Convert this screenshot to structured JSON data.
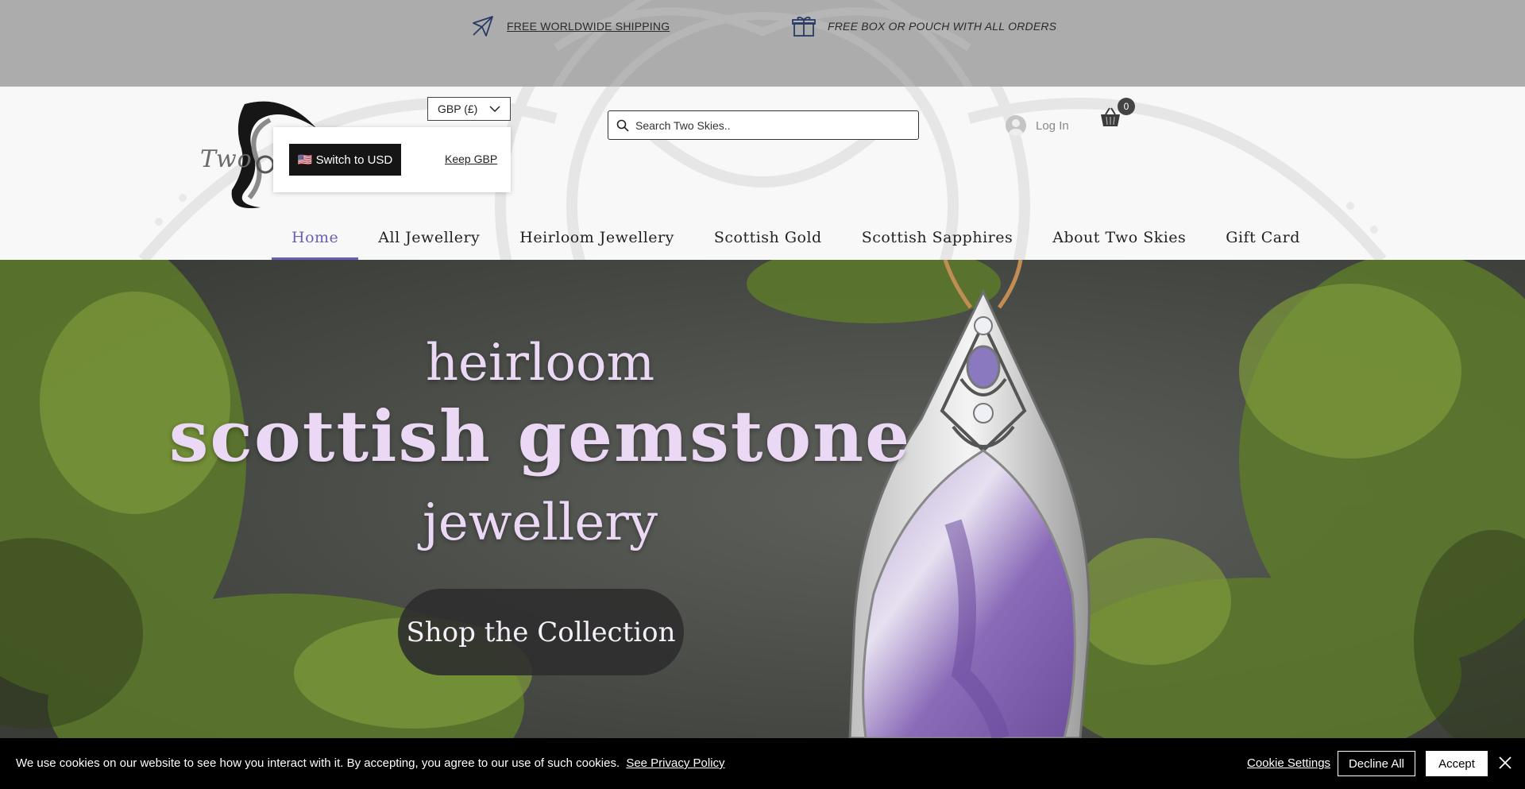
{
  "promo": {
    "shipping_text": "FREE WORLDWIDE SHIPPING",
    "shipping_icon": "airplane-icon",
    "box_text": "FREE BOX OR POUCH WITH ALL ORDERS",
    "box_icon": "gift-icon"
  },
  "header": {
    "logo_text": "Two",
    "currency": {
      "selected": "GBP (£)",
      "switch_label": "🇺🇸 Switch to USD",
      "keep_label": "Keep GBP"
    },
    "search": {
      "placeholder": "Search Two Skies.."
    },
    "login_label": "Log In",
    "cart_count": "0"
  },
  "nav": {
    "items": [
      {
        "label": "Home",
        "active": true
      },
      {
        "label": "All Jewellery"
      },
      {
        "label": "Heirloom Jewellery"
      },
      {
        "label": "Scottish Gold"
      },
      {
        "label": "Scottish Sapphires"
      },
      {
        "label": "About Two Skies"
      },
      {
        "label": "Gift Card"
      }
    ]
  },
  "hero": {
    "line1": "heirloom",
    "line2": "scottish gemstone",
    "line3": "jewellery",
    "cta_label": "Shop the Collection"
  },
  "cookie": {
    "message": "We use cookies on our website to see how you interact with it. By accepting, you agree to our use of such cookies.",
    "privacy_link": "See Privacy Policy",
    "settings_label": "Cookie Settings",
    "decline_label": "Decline All",
    "accept_label": "Accept"
  },
  "colors": {
    "promo_bg": "#acacac",
    "header_bg": "#f8f8f8",
    "nav_active": "#6a5fb0",
    "hero_text": "#ead8f5",
    "cta_bg": "#2d2d2d",
    "cookie_bg": "#000000"
  }
}
